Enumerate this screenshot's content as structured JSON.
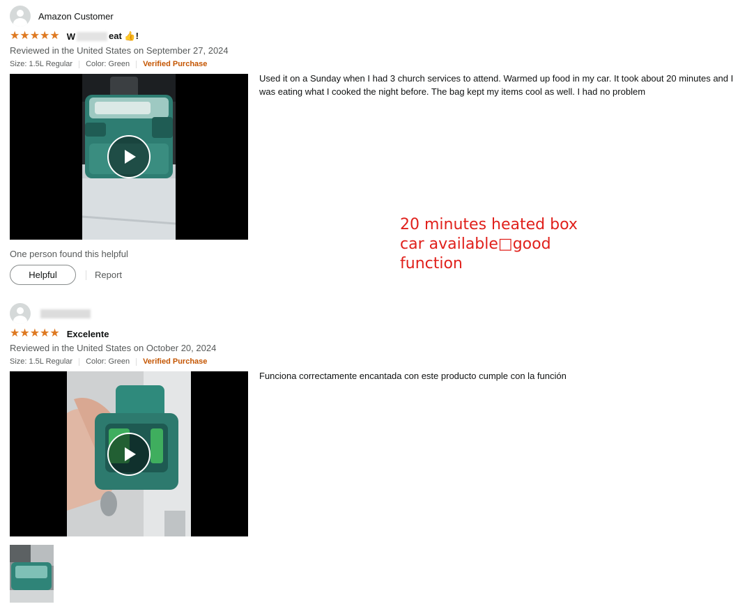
{
  "reviews": [
    {
      "reviewer": "Amazon Customer",
      "stars": "★★★★★",
      "title_start": "W",
      "title_end": "eat 👍!",
      "date": "Reviewed in the United States on September 27, 2024",
      "size": "Size: 1.5L Regular",
      "color": "Color: Green",
      "verified": "Verified Purchase",
      "body": "Used it on a Sunday when I had 3 church services to attend. Warmed up food in my car. It took about 20 minutes and I was eating what I cooked the night before. The bag kept my items cool as well. I had no problem",
      "helpful_count_text": "One person found this helpful",
      "helpful_button": "Helpful",
      "report": "Report"
    },
    {
      "reviewer": "",
      "stars": "★★★★★",
      "title": "Excelente",
      "date": "Reviewed in the United States on October 20, 2024",
      "size": "Size: 1.5L Regular",
      "color": "Color: Green",
      "verified": "Verified Purchase",
      "body": "Funciona correctamente encantada con este producto cumple con la función"
    }
  ],
  "annotation": {
    "line1": "20 minutes heated box",
    "line2": "car available□good",
    "line3": "function"
  },
  "colors": {
    "star": "#de7921",
    "verified": "#c45500",
    "annotation": "#e0201b",
    "secondary_text": "#565959"
  }
}
